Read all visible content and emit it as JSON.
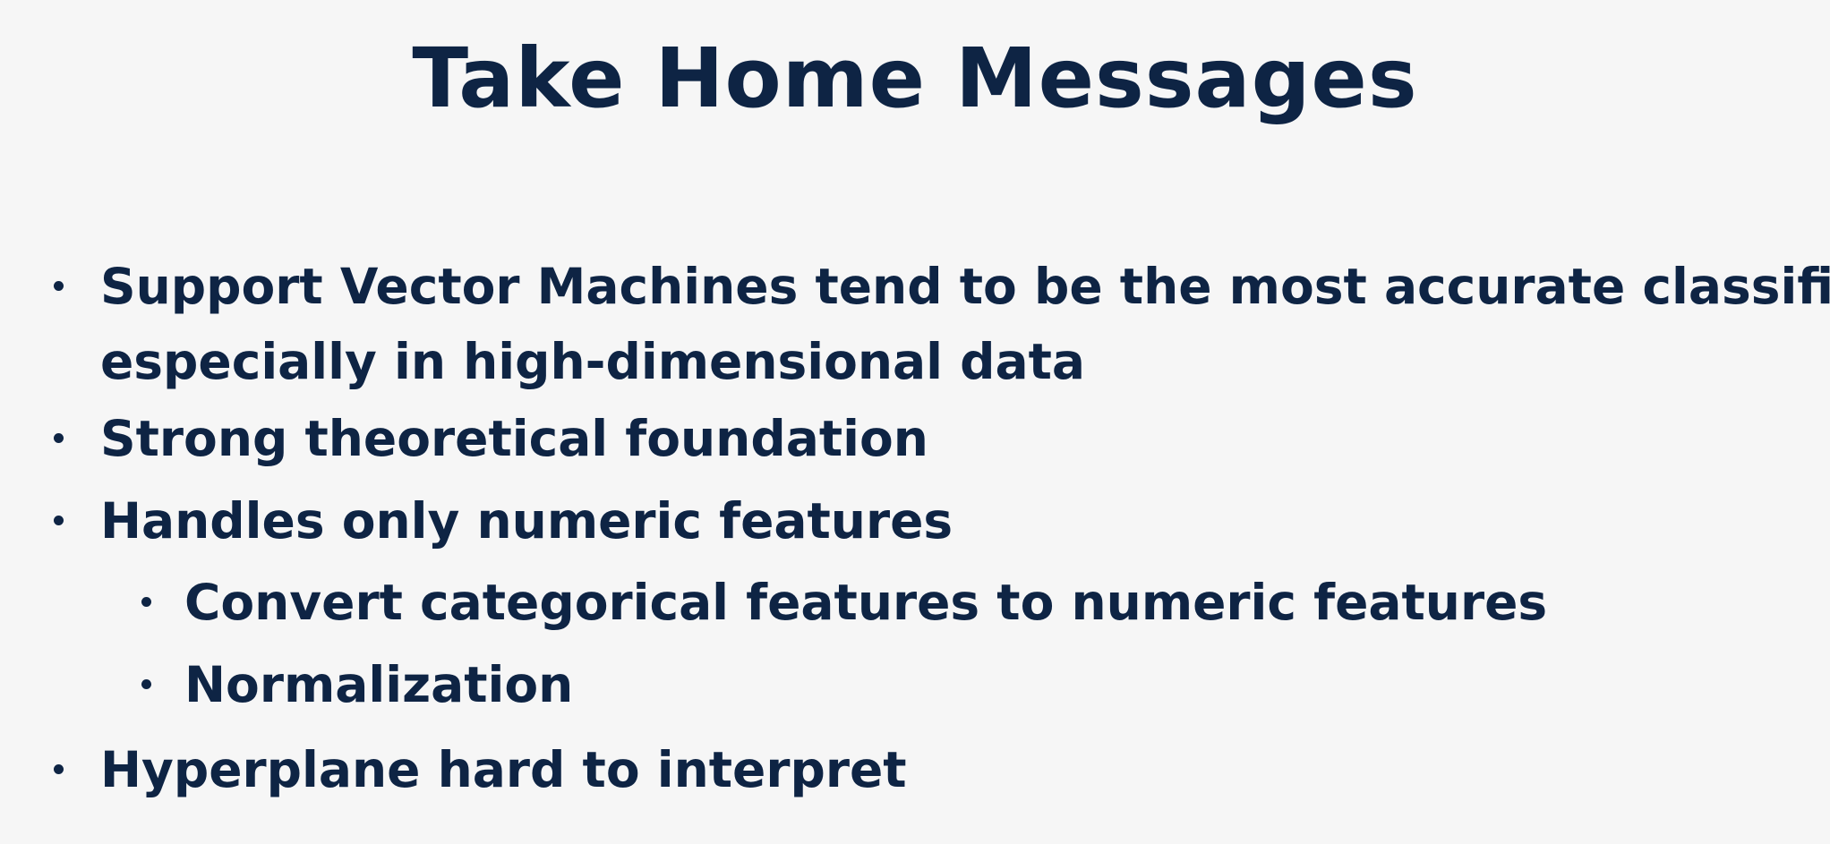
{
  "slide": {
    "title": "Take Home Messages",
    "bullets": [
      {
        "level": 1,
        "line1": "Support Vector Machines tend to be the most accurate classifiers,",
        "line2": "especially in high-dimensional data"
      },
      {
        "level": 1,
        "text": "Strong theoretical foundation"
      },
      {
        "level": 1,
        "text": "Handles only numeric features"
      },
      {
        "level": 2,
        "text": "Convert categorical features to numeric features"
      },
      {
        "level": 2,
        "text": "Normalization"
      },
      {
        "level": 1,
        "text": "Hyperplane hard to interpret"
      }
    ]
  }
}
